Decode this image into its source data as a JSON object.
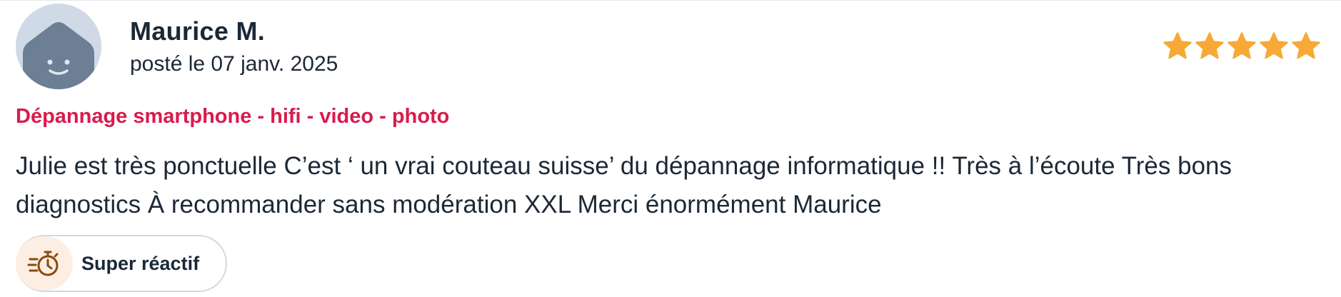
{
  "review": {
    "author": "Maurice M.",
    "posted": "posté le 07 janv. 2025",
    "rating": 5,
    "rating_max": 5,
    "service": "Dépannage smartphone - hifi - video - photo",
    "text": "Julie est très ponctuelle C’est ‘ un vrai couteau suisse’ du dépannage informatique !! Très à l’écoute Très bons diagnostics À recommander sans modération XXL Merci énormément Maurice",
    "badge": {
      "label": "Super réactif",
      "icon": "stopwatch-icon"
    }
  },
  "colors": {
    "star": "#f7a936",
    "service": "#d81b4d",
    "avatar_bg": "#cfdae6",
    "avatar_face": "#6c7f94",
    "badge_icon": "#8a4a10",
    "badge_icon_bg": "#fdeee3"
  }
}
